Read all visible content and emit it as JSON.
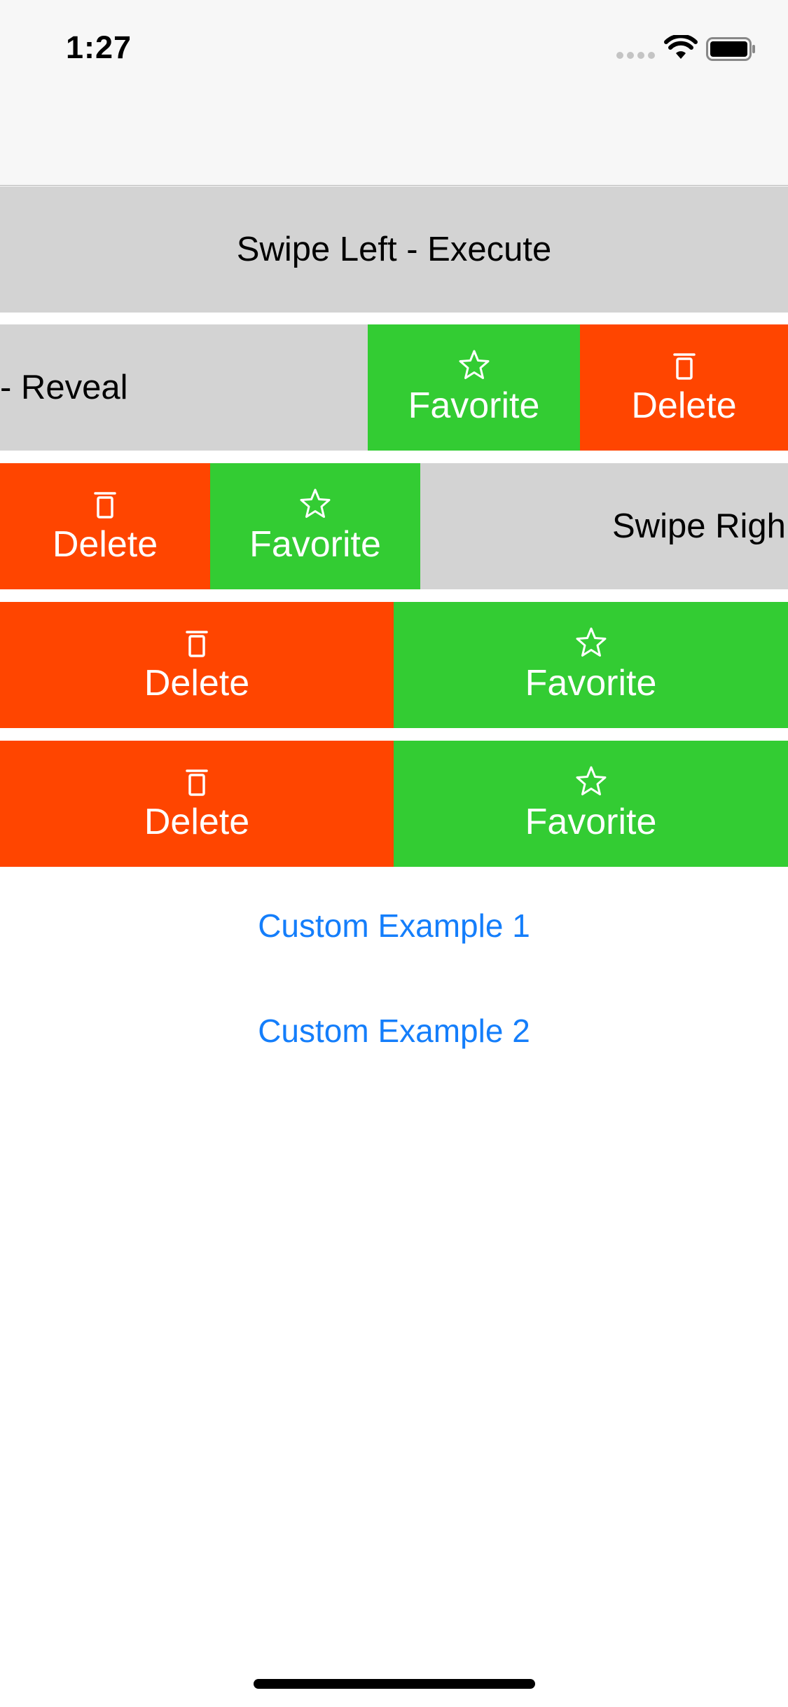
{
  "status_bar": {
    "time": "1:27"
  },
  "rows": {
    "row1": {
      "label": "Swipe Left - Execute"
    },
    "row2": {
      "label": "- Reveal",
      "favorite_label": "Favorite",
      "delete_label": "Delete"
    },
    "row3": {
      "delete_label": "Delete",
      "favorite_label": "Favorite",
      "label": "Swipe Righ"
    },
    "row4": {
      "delete_label": "Delete",
      "favorite_label": "Favorite"
    },
    "row5": {
      "delete_label": "Delete",
      "favorite_label": "Favorite"
    }
  },
  "links": {
    "custom_example_1": "Custom Example 1",
    "custom_example_2": "Custom Example 2"
  },
  "colors": {
    "favorite_green": "#33cc33",
    "delete_red": "#ff4500",
    "row_gray": "#d3d3d3",
    "link_blue": "#147efb",
    "bar_background": "#f7f7f7"
  },
  "icons": {
    "favorite": "star-outline-icon",
    "delete": "trash-icon"
  }
}
